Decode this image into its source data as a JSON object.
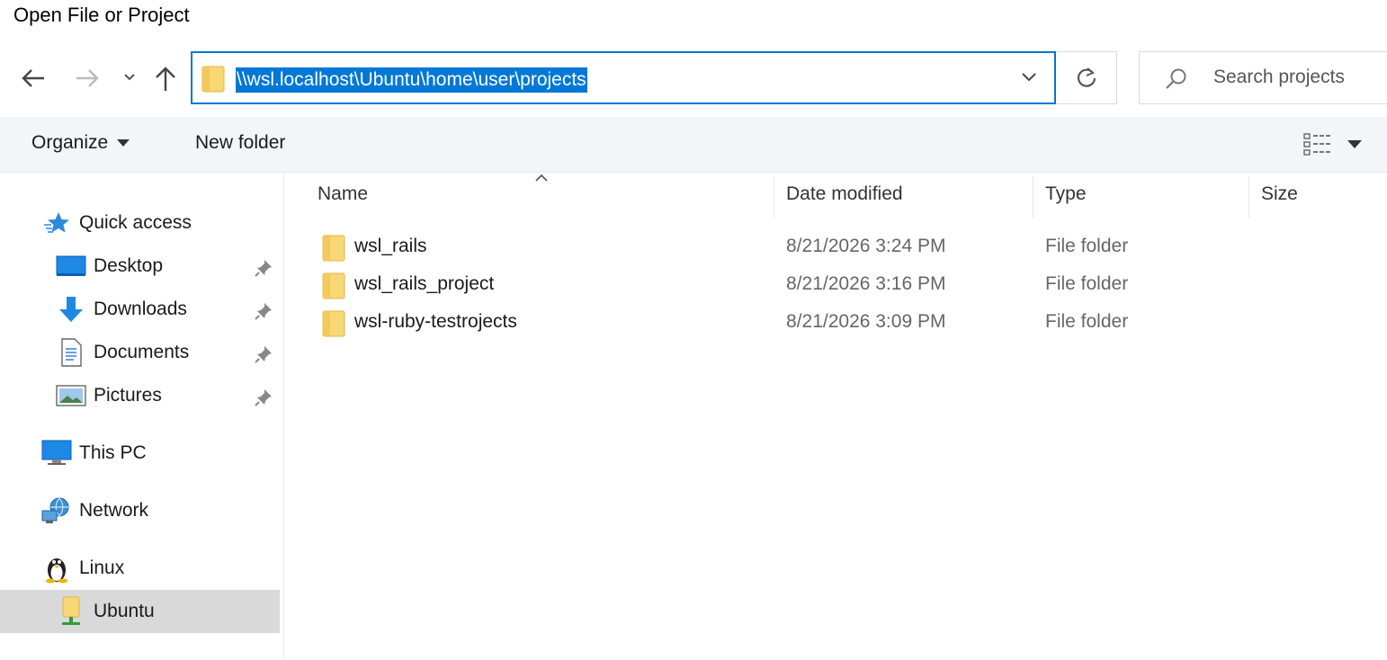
{
  "window": {
    "title": "Open File or Project"
  },
  "address_bar": {
    "path": "\\\\wsl.localhost\\Ubuntu\\home\\user\\projects"
  },
  "search": {
    "placeholder": "Search projects"
  },
  "command_bar": {
    "organize_label": "Organize",
    "new_folder_label": "New folder"
  },
  "sidebar": {
    "quick_access": "Quick access",
    "items": [
      {
        "label": "Desktop",
        "icon": "desktop-icon",
        "pinned": true
      },
      {
        "label": "Downloads",
        "icon": "downloads-icon",
        "pinned": true
      },
      {
        "label": "Documents",
        "icon": "documents-icon",
        "pinned": true
      },
      {
        "label": "Pictures",
        "icon": "pictures-icon",
        "pinned": true
      }
    ],
    "this_pc": "This PC",
    "network": "Network",
    "linux": "Linux",
    "ubuntu": "Ubuntu",
    "selected": "Ubuntu"
  },
  "columns": {
    "name": "Name",
    "date": "Date modified",
    "type": "Type",
    "size": "Size"
  },
  "files": [
    {
      "name": "wsl_rails",
      "date": "8/21/2026 3:24 PM",
      "type": "File folder"
    },
    {
      "name": "wsl_rails_project",
      "date": "8/21/2026 3:16 PM",
      "type": "File folder"
    },
    {
      "name": "wsl-ruby-testrojects",
      "date": "8/21/2026 3:09 PM",
      "type": "File folder"
    }
  ],
  "colors": {
    "accent": "#0078d7",
    "folder": "#f8d775",
    "selected": "#d9d9d9"
  }
}
